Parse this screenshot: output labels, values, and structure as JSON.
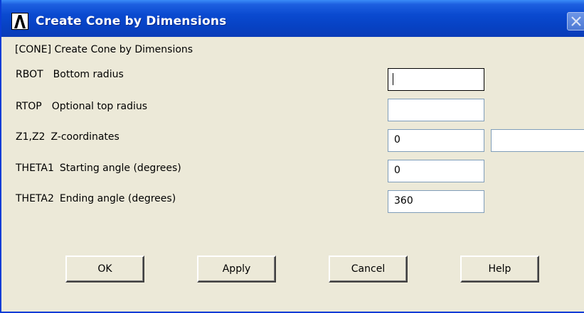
{
  "window": {
    "title": "Create Cone by Dimensions"
  },
  "dialog": {
    "command_line": "[CONE]  Create Cone by Dimensions",
    "fields": [
      {
        "code": "RBOT",
        "description": "Bottom radius",
        "value": ""
      },
      {
        "code": "RTOP",
        "description": "Optional top radius",
        "value": ""
      },
      {
        "code": "Z1,Z2",
        "description": "Z-coordinates",
        "value": "0",
        "value2": ""
      },
      {
        "code": "THETA1",
        "description": "Starting angle (degrees)",
        "value": "0"
      },
      {
        "code": "THETA2",
        "description": "Ending angle (degrees)",
        "value": "360"
      }
    ]
  },
  "buttons": {
    "ok": "OK",
    "apply": "Apply",
    "cancel": "Cancel",
    "help": "Help"
  },
  "colors": {
    "titlebar": "#0a4ad0",
    "background": "#ece9d8",
    "title_text": "#ffffff"
  },
  "icons": {
    "app_logo": "ansys-logo-icon",
    "close": "close-icon"
  }
}
